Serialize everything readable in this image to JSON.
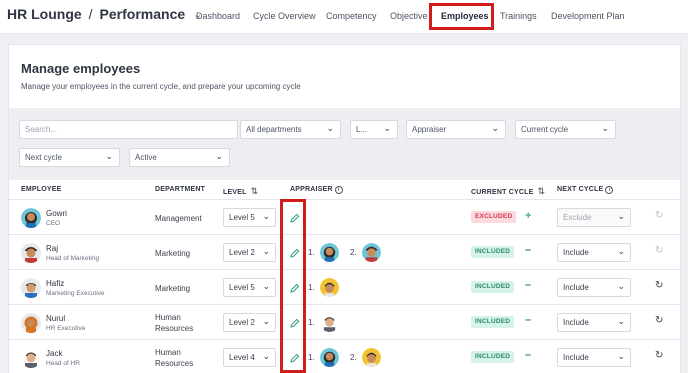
{
  "brand": {
    "app": "HR Lounge",
    "module": "Performance"
  },
  "nav": [
    "Dashboard",
    "Cycle Overview",
    "Competency",
    "Objective",
    "Employees",
    "Trainings",
    "Development Plan"
  ],
  "nav_active": "Employees",
  "card": {
    "title": "Manage employees",
    "subtitle": "Manage your employees in the current cycle, and prepare your upcoming cycle"
  },
  "filters": {
    "search_placeholder": "Search...",
    "department": "All departments",
    "level": "L...",
    "appraiser": "Appraiser",
    "current_cycle": "Current cycle",
    "next_cycle": "Next cycle",
    "status": "Active"
  },
  "columns": {
    "employee": "EMPLOYEE",
    "department": "DEPARTMENT",
    "level": "LEVEL",
    "appraiser": "APPRAISER",
    "current_cycle": "CURRENT CYCLE",
    "next_cycle": "NEXT CYCLE"
  },
  "rows": [
    {
      "name": "Gowri",
      "role": "CEO",
      "department": "Management",
      "level": "Level 5",
      "current": "EXCLUDED",
      "next": "Exclude"
    },
    {
      "name": "Raj",
      "role": "Head of Marketing",
      "department": "Marketing",
      "level": "Level 2",
      "ap1": "1.",
      "ap2": "2.",
      "current": "INCLUDED",
      "next": "Include"
    },
    {
      "name": "Hafiz",
      "role": "Marketing Executive",
      "department": "Marketing",
      "level": "Level 5",
      "ap1": "1.",
      "current": "INCLUDED",
      "next": "Include"
    },
    {
      "name": "Nurul",
      "role": "HR Executive",
      "department": "Human Resources",
      "level": "Level 2",
      "ap1": "1.",
      "current": "INCLUDED",
      "next": "Include"
    },
    {
      "name": "Jack",
      "role": "Head of HR",
      "department": "Human Resources",
      "level": "Level 4",
      "ap1": "1.",
      "ap2": "2.",
      "current": "INCLUDED",
      "next": "Include"
    }
  ],
  "colors": {
    "highlight": "#d21b1b",
    "included": "#2b8a6e",
    "excluded": "#d63b52"
  }
}
